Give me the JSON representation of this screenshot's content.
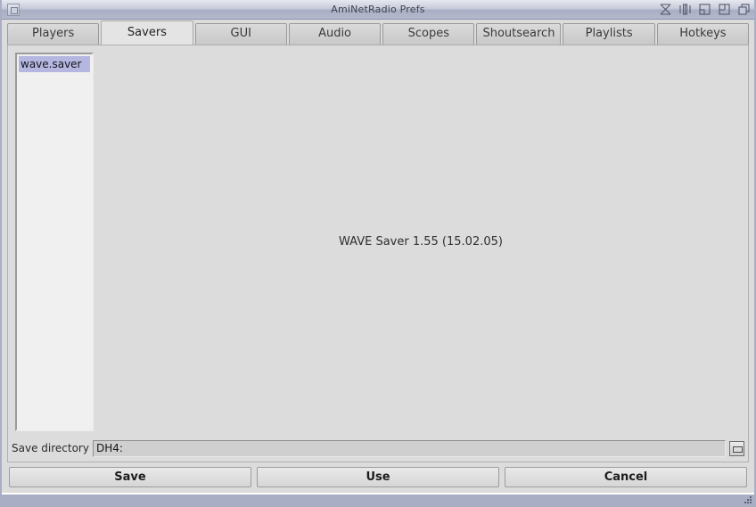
{
  "window": {
    "title": "AmiNetRadio Prefs",
    "close_gadget": "close-gadget",
    "gadgets": [
      {
        "name": "iconify-gadget",
        "glyph": "hourglass"
      },
      {
        "name": "snapshot-gadget",
        "glyph": "snapshot"
      },
      {
        "name": "zoom-gadget",
        "glyph": "zoom"
      },
      {
        "name": "maximize-gadget",
        "glyph": "maximize"
      },
      {
        "name": "depth-gadget",
        "glyph": "depth"
      }
    ]
  },
  "tabs": [
    {
      "label": "Players",
      "active": false
    },
    {
      "label": "Savers",
      "active": true
    },
    {
      "label": "GUI",
      "active": false
    },
    {
      "label": "Audio",
      "active": false
    },
    {
      "label": "Scopes",
      "active": false
    },
    {
      "label": "Shoutsearch",
      "active": false
    },
    {
      "label": "Playlists",
      "active": false
    },
    {
      "label": "Hotkeys",
      "active": false
    }
  ],
  "savers_list": [
    {
      "label": "wave.saver",
      "selected": true
    }
  ],
  "info": {
    "text": "WAVE Saver 1.55 (15.02.05)"
  },
  "save_directory": {
    "label": "Save directory",
    "value": "DH4:",
    "placeholder": "",
    "popup_button": "directory-popup-button"
  },
  "buttons": [
    {
      "label": "Save"
    },
    {
      "label": "Use"
    },
    {
      "label": "Cancel"
    }
  ],
  "colors": {
    "titlebar": "#a9aec4",
    "content_bg": "#dcdcdc",
    "list_bg": "#f0f0f0",
    "selection": "#b6b7e0",
    "field_bg": "#cfcfcf",
    "statusbar": "#a9aec4"
  }
}
